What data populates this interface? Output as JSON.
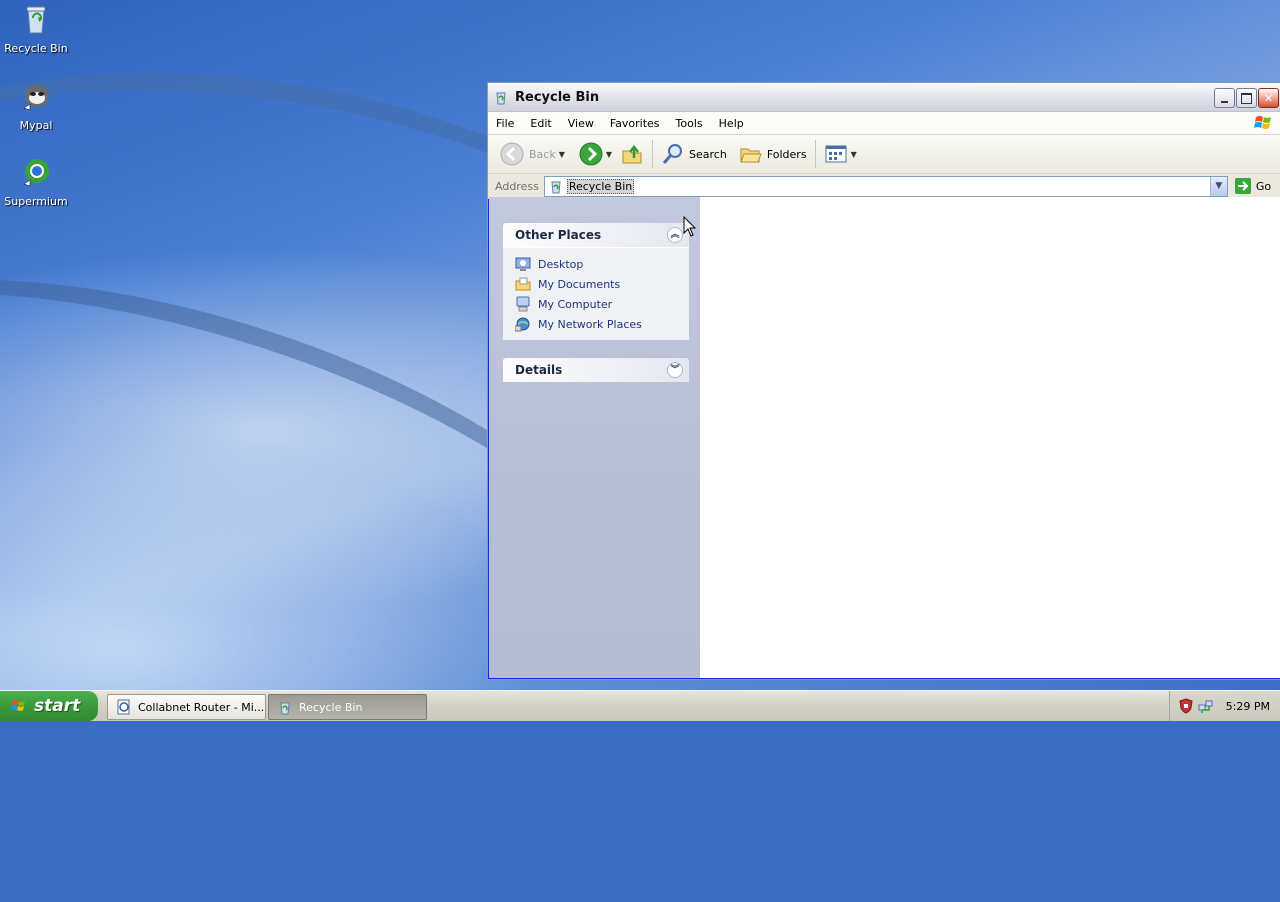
{
  "desktop": {
    "icons": [
      {
        "label": "Recycle Bin",
        "icon": "recycle-bin-icon"
      },
      {
        "label": "Mypal",
        "icon": "mypal-icon"
      },
      {
        "label": "Supermium",
        "icon": "supermium-icon"
      }
    ]
  },
  "window": {
    "title": "Recycle Bin",
    "controls": {
      "minimize": "minimize-icon",
      "maximize": "maximize-icon",
      "close": "close-icon"
    }
  },
  "menubar": {
    "items": [
      "File",
      "Edit",
      "View",
      "Favorites",
      "Tools",
      "Help"
    ]
  },
  "toolbar": {
    "back_label": "Back",
    "search_label": "Search",
    "folders_label": "Folders"
  },
  "addressbar": {
    "label": "Address",
    "value": "Recycle Bin",
    "go_label": "Go"
  },
  "taskpane": {
    "other_places": {
      "title": "Other Places",
      "items": [
        "Desktop",
        "My Documents",
        "My Computer",
        "My Network Places"
      ]
    },
    "details": {
      "title": "Details"
    }
  },
  "taskbar": {
    "start_label": "start",
    "tasks": [
      "Collabnet Router - Mi...",
      "Recycle Bin"
    ],
    "clock": "5:29 PM"
  },
  "colors": {
    "title_text": "#111111",
    "link_text": "#21347f",
    "start_green": "#3c9a3c",
    "desktop_blue": "#3a6cc4"
  }
}
